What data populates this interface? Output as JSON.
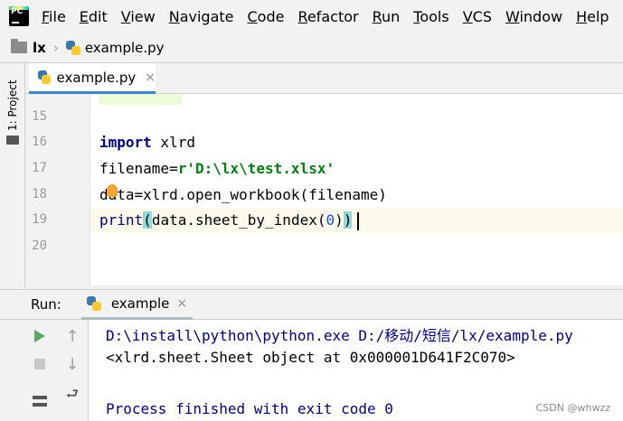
{
  "menu": {
    "items": [
      "File",
      "Edit",
      "View",
      "Navigate",
      "Code",
      "Refactor",
      "Run",
      "Tools",
      "VCS",
      "Window",
      "Help"
    ]
  },
  "app": {
    "logo_text": "PC",
    "logo_icon": "pycharm-logo-icon"
  },
  "navbar": {
    "folder": "lx",
    "file": "example.py"
  },
  "left_strip": {
    "project_tab": "1: Project"
  },
  "editor": {
    "tab": {
      "label": "example.py",
      "close": "×"
    },
    "lines": [
      {
        "num": "15",
        "text": ""
      },
      {
        "num": "16",
        "text": "import xlrd"
      },
      {
        "num": "17",
        "text": "filename=r'D:\\lx\\test.xlsx'"
      },
      {
        "num": "18",
        "text": "data=xlrd.open_workbook(filename)"
      },
      {
        "num": "19",
        "text": "print(data.sheet_by_index(0))"
      },
      {
        "num": "20",
        "text": ""
      }
    ],
    "tokens": {
      "import_kw": "import",
      "import_mod": " xlrd",
      "fname_var": "filename=",
      "fname_str": "r'D:\\lx\\test.xlsx'",
      "data_code": "data=xlrd.open_workbook(filename)",
      "print_fn": "print",
      "open_paren": "(",
      "call": "data.sheet_by_index(",
      "zero": "0",
      "close_inner": ")",
      "close_paren": ")"
    }
  },
  "run": {
    "label": "Run:",
    "tab": {
      "label": "example",
      "close": "×"
    },
    "tools": [
      "rerun-icon",
      "stop-icon",
      "layout-icon",
      "scroll-up-icon",
      "scroll-down-icon",
      "soft-wrap-icon"
    ],
    "console": [
      "D:\\install\\python\\python.exe D:/移动/短信/lx/example.py",
      "<xlrd.sheet.Sheet object at 0x000001D641F2C070>",
      "",
      "Process finished with exit code 0"
    ]
  },
  "watermark": "CSDN @whwzz",
  "colors": {
    "keyword": "#000080",
    "string": "#067d17",
    "number": "#1750eb",
    "accent": "#4083c9",
    "run_green": "#59a869"
  }
}
